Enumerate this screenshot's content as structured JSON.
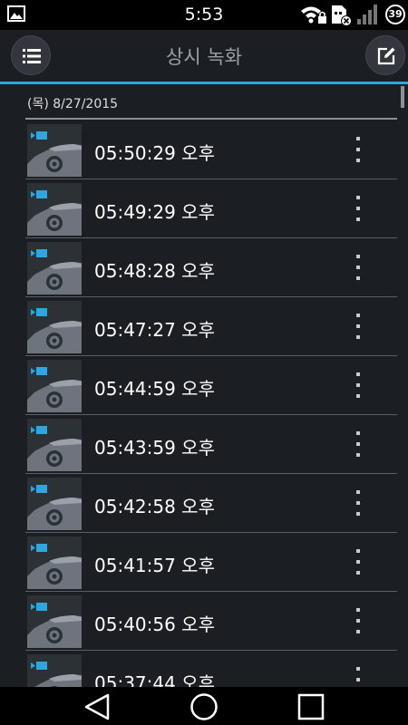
{
  "status_bar": {
    "time": "5:53",
    "battery": "39",
    "icons": [
      "gallery-icon",
      "wifi-lock-icon",
      "sim-blocked-icon",
      "signal-icon",
      "battery-icon"
    ]
  },
  "app_bar": {
    "title": "상시 녹화",
    "left_icon": "menu-list-icon",
    "right_icon": "edit-icon",
    "accent_color": "#2ea7e0"
  },
  "list": {
    "date": "(목) 8/27/2015",
    "items": [
      {
        "time": "05:50:29 오후"
      },
      {
        "time": "05:49:29 오후"
      },
      {
        "time": "05:48:28 오후"
      },
      {
        "time": "05:47:27 오후"
      },
      {
        "time": "05:44:59 오후"
      },
      {
        "time": "05:43:59 오후"
      },
      {
        "time": "05:42:58 오후"
      },
      {
        "time": "05:41:57 오후"
      },
      {
        "time": "05:40:56 오후"
      },
      {
        "time": "05:37:44 오후"
      }
    ]
  },
  "nav_bar": {
    "icons": [
      "back-icon",
      "home-icon",
      "recents-icon"
    ]
  }
}
